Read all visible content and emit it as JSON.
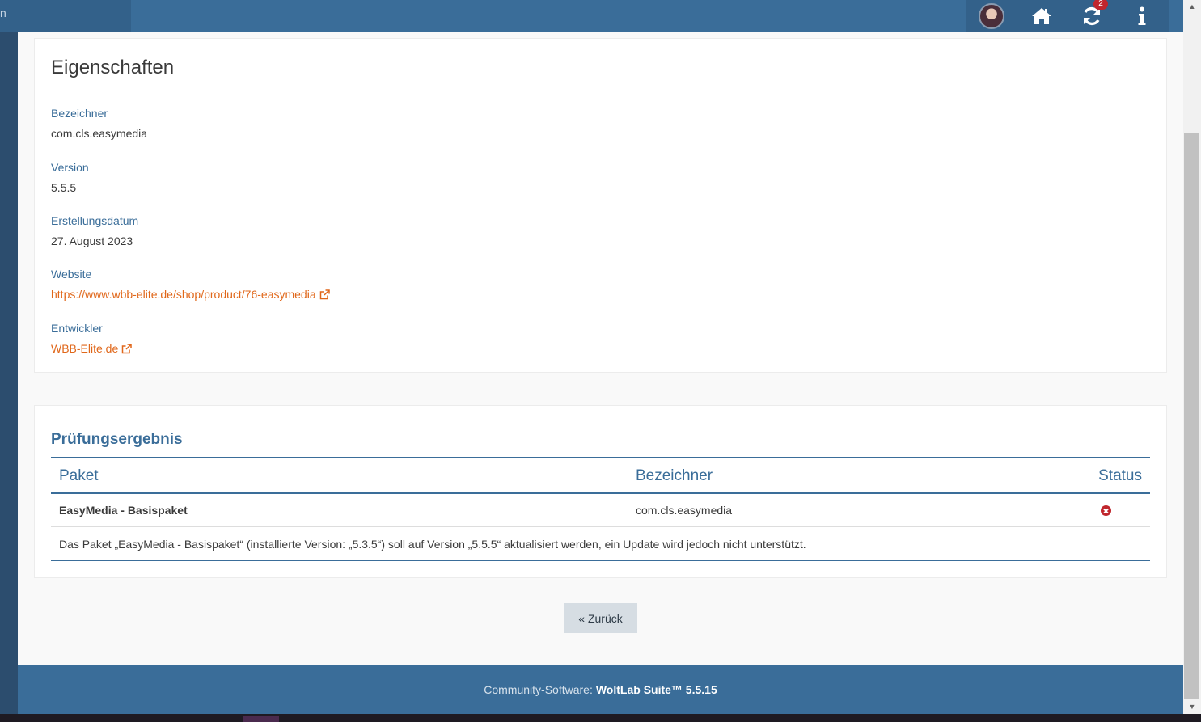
{
  "topbar": {
    "left_char": "n",
    "notification_count": "2",
    "icons": [
      "avatar",
      "home-icon",
      "refresh-icon",
      "info-icon"
    ]
  },
  "properties": {
    "title": "Eigenschaften",
    "identifier_label": "Bezeichner",
    "identifier_value": "com.cls.easymedia",
    "version_label": "Version",
    "version_value": "5.5.5",
    "date_label": "Erstellungsdatum",
    "date_value": "27. August 2023",
    "website_label": "Website",
    "website_value": "https://www.wbb-elite.de/shop/product/76-easymedia",
    "developer_label": "Entwickler",
    "developer_value": "WBB-Elite.de"
  },
  "check": {
    "title": "Prüfungsergebnis",
    "columns": [
      "Paket",
      "Bezeichner",
      "Status"
    ],
    "rows": [
      {
        "package": "EasyMedia - Basispaket",
        "identifier": "com.cls.easymedia",
        "status": "error"
      }
    ],
    "message": "Das Paket „EasyMedia - Basispaket“ (installierte Version: „5.3.5“) soll auf Version „5.5.5“ aktualisiert werden, ein Update wird jedoch nicht unterstützt."
  },
  "back_button": "« Zurück",
  "footer": {
    "prefix": "Community-Software:",
    "product": "WoltLab Suite™ 5.5.15"
  },
  "colors": {
    "accent": "#3a6d99",
    "link": "#e0671a",
    "error": "#c0262d"
  }
}
